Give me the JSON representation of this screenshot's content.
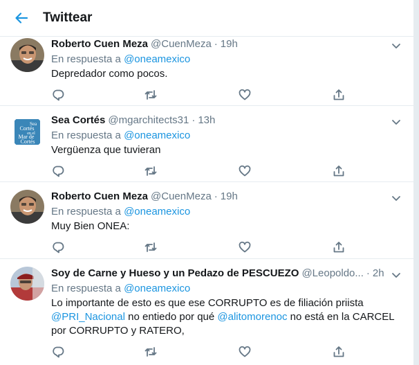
{
  "header": {
    "title": "Twittear"
  },
  "reply_prefix": "En respuesta a",
  "tweets": [
    {
      "name": "Roberto Cuen Meza",
      "handle": "@CuenMeza",
      "time": "19h",
      "reply_to": "@oneamexico",
      "text": "Depredador como pocos."
    },
    {
      "name": "Sea Cortés",
      "handle": "@mgarchitects31",
      "time": "13h",
      "reply_to": "@oneamexico",
      "text": "Vergüenza que tuvieran",
      "avatar_words": [
        "Sea",
        "Cortés",
        "en el",
        "Mar de",
        "Cortés"
      ]
    },
    {
      "name": "Roberto Cuen Meza",
      "handle": "@CuenMeza",
      "time": "19h",
      "reply_to": "@oneamexico",
      "text": "Muy Bien ONEA:"
    },
    {
      "name": "Soy de Carne y Hueso y un Pedazo de PESCUEZO",
      "handle": "@Leopoldo...",
      "time": "2h",
      "reply_to": "@oneamexico",
      "text_1": "Lo importante de esto es que ese CORRUPTO es de filiación priista",
      "mention_1": "@PRI_Nacional",
      "text_2": " no entiedo por qué ",
      "mention_2": "@alitomorenoc",
      "text_3": " no está en la CARCEL",
      "text_4": "por CORRUPTO y RATERO,"
    }
  ],
  "colors": {
    "accent": "#1b95e0",
    "muted": "#657786",
    "divider": "#e6ecf0"
  },
  "icons": [
    "back-arrow-icon",
    "chevron-down-icon",
    "reply-icon",
    "retweet-icon",
    "like-icon",
    "share-icon"
  ]
}
